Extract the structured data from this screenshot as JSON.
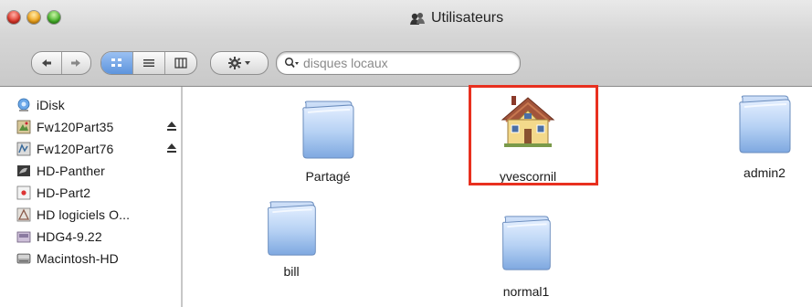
{
  "window": {
    "title": "Utilisateurs"
  },
  "toolbar": {
    "search": {
      "placeholder": "disques locaux"
    }
  },
  "sidebar": {
    "items": [
      {
        "label": "iDisk",
        "icon": "idisk-icon",
        "eject": false
      },
      {
        "label": "Fw120Part35",
        "icon": "firewire-drive-icon",
        "eject": true
      },
      {
        "label": "Fw120Part76",
        "icon": "firewire-drive-icon",
        "eject": true
      },
      {
        "label": "HD-Panther",
        "icon": "hard-drive-icon",
        "eject": false
      },
      {
        "label": "HD-Part2",
        "icon": "hard-drive-icon",
        "eject": false
      },
      {
        "label": "HD logiciels O...",
        "icon": "hard-drive-icon",
        "eject": false
      },
      {
        "label": "HDG4-9.22",
        "icon": "hard-drive-icon",
        "eject": false
      },
      {
        "label": "Macintosh-HD",
        "icon": "hard-drive-icon",
        "eject": false
      }
    ]
  },
  "content": {
    "items": [
      {
        "label": "Partagé",
        "icon": "folder-icon"
      },
      {
        "label": "yvescornil",
        "icon": "home-icon"
      },
      {
        "label": "admin2",
        "icon": "folder-icon"
      },
      {
        "label": "bill",
        "icon": "folder-icon"
      },
      {
        "label": "normal1",
        "icon": "folder-icon"
      }
    ]
  },
  "colors": {
    "highlight": "#e8301f",
    "selected_view": "#5d94dd",
    "folder_blue": "#a9c8ee"
  }
}
